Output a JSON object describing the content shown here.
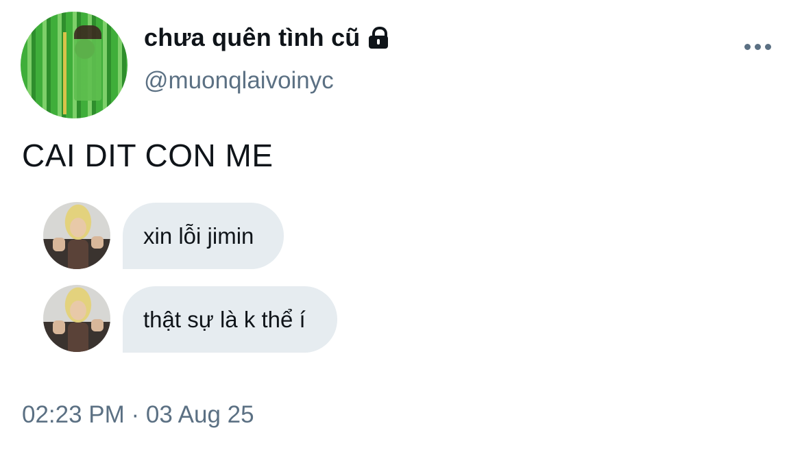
{
  "profile": {
    "display_name": "chưa quên tình cũ",
    "handle": "@muonqlaivoinyc",
    "lock_icon": "lock-icon"
  },
  "tweet": {
    "text": "CAI DIT CON ME",
    "timestamp": "02:23 PM · 03 Aug 25"
  },
  "messages": [
    {
      "text": "xin lỗi jimin"
    },
    {
      "text": "thật sự là k thể í"
    }
  ],
  "colors": {
    "text": "#0f1419",
    "secondary": "#5b7083",
    "bubble": "#e6ecf0",
    "background": "#ffffff"
  }
}
